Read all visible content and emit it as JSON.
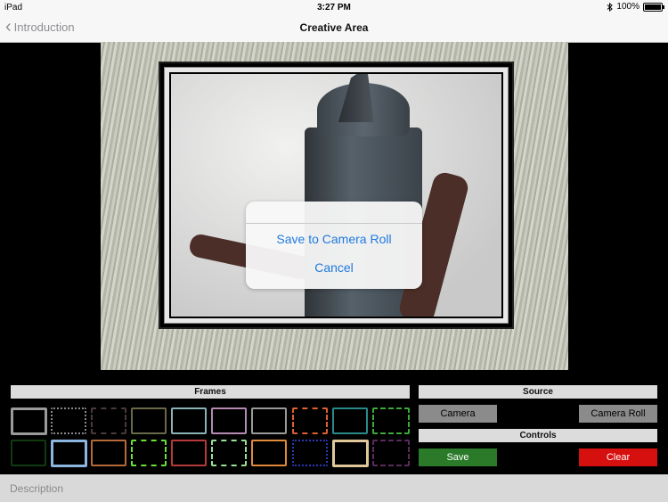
{
  "status": {
    "carrier": "iPad",
    "time": "3:27 PM",
    "battery": "100%",
    "battery_level": 1.0,
    "icons": [
      "bluetooth-icon",
      "battery-icon"
    ]
  },
  "nav": {
    "back_label": "Introduction",
    "title": "Creative Area",
    "back_icon": "chevron-left-icon"
  },
  "dialog": {
    "save_label": "Save to Camera Roll",
    "cancel_label": "Cancel"
  },
  "frames": {
    "title": "Frames"
  },
  "source": {
    "title": "Source",
    "camera_label": "Camera",
    "camera_roll_label": "Camera Roll"
  },
  "controls": {
    "title": "Controls",
    "save_label": "Save",
    "clear_label": "Clear"
  },
  "description": {
    "placeholder": "Description"
  },
  "colors": {
    "accent": "#1f7ae0",
    "save": "#2a7a2a",
    "clear": "#d60f0f",
    "section": "#dcdcdc"
  }
}
